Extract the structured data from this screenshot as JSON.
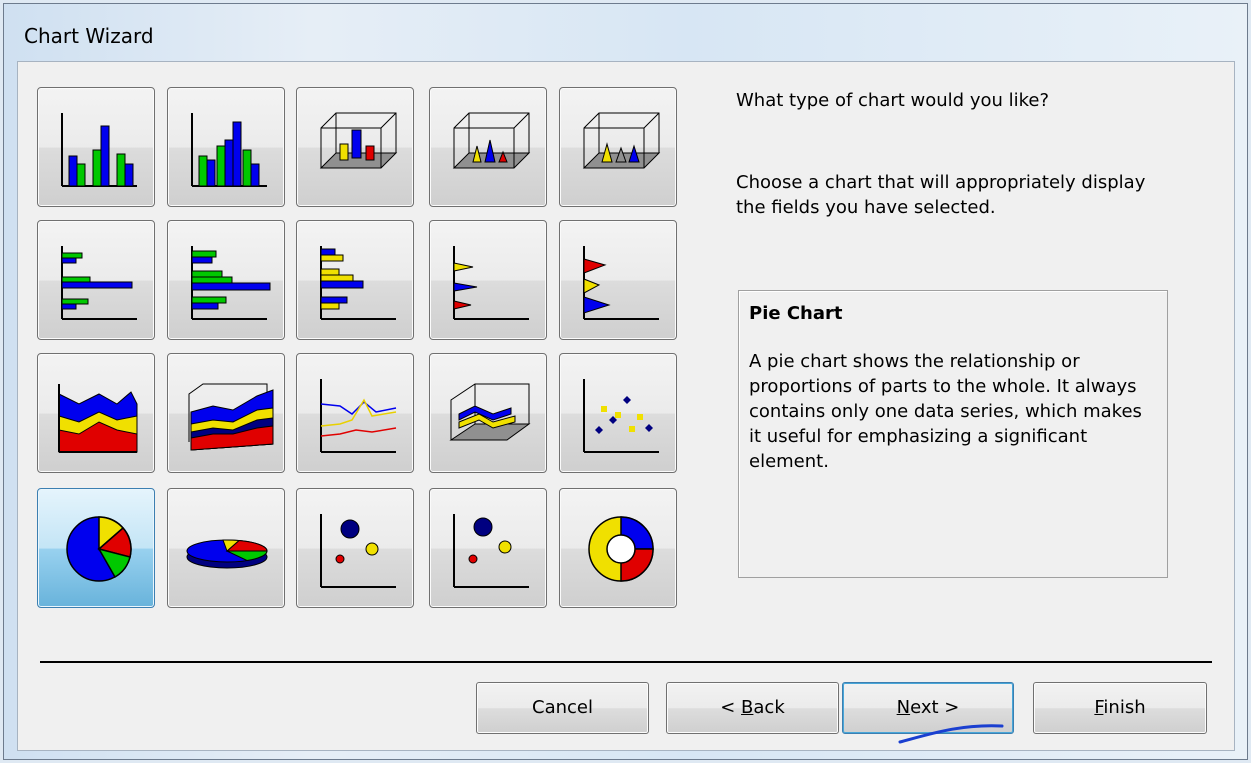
{
  "window": {
    "title": "Chart Wizard"
  },
  "question": "What type of chart would you like?",
  "instruction": "Choose a chart that will appropriately display the fields you have selected.",
  "description": {
    "title": "Pie Chart",
    "text": "A pie chart shows the relationship or proportions of parts to the whole. It always contains only one data series, which makes it useful for emphasizing a significant element."
  },
  "chart_types": [
    {
      "icon": "column-clustered-icon",
      "selected": false
    },
    {
      "icon": "column-clustered-3d-icon",
      "selected": false
    },
    {
      "icon": "cylinder-3d-icon",
      "selected": false
    },
    {
      "icon": "cone-3d-icon",
      "selected": false
    },
    {
      "icon": "pyramid-3d-icon",
      "selected": false
    },
    {
      "icon": "bar-clustered-icon",
      "selected": false
    },
    {
      "icon": "bar-clustered-3d-icon",
      "selected": false
    },
    {
      "icon": "bar-cylinder-icon",
      "selected": false
    },
    {
      "icon": "bar-cone-icon",
      "selected": false
    },
    {
      "icon": "bar-pyramid-icon",
      "selected": false
    },
    {
      "icon": "area-icon",
      "selected": false
    },
    {
      "icon": "area-3d-icon",
      "selected": false
    },
    {
      "icon": "line-icon",
      "selected": false
    },
    {
      "icon": "line-3d-icon",
      "selected": false
    },
    {
      "icon": "scatter-icon",
      "selected": false
    },
    {
      "icon": "pie-icon",
      "selected": true
    },
    {
      "icon": "pie-3d-icon",
      "selected": false
    },
    {
      "icon": "bubble-icon",
      "selected": false
    },
    {
      "icon": "bubble-3d-icon",
      "selected": false
    },
    {
      "icon": "doughnut-icon",
      "selected": false
    }
  ],
  "buttons": {
    "cancel": "Cancel",
    "back_prefix": "< ",
    "back_key": "B",
    "back_rest": "ack",
    "next_key": "N",
    "next_rest": "ext >",
    "finish_key": "F",
    "finish_rest": "inish"
  },
  "colors": {
    "blue": "#0000ee",
    "green": "#00c800",
    "red": "#e00000",
    "yellow": "#f0e000",
    "navy": "#000080"
  }
}
